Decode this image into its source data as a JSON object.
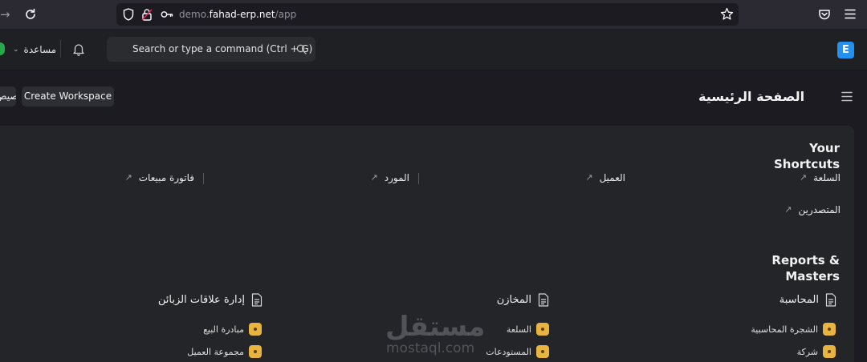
{
  "browser": {
    "url_prefix": "demo.",
    "url_host": "fahad-erp.net",
    "url_path": "/app",
    "icons": [
      "forward-icon",
      "reload-icon",
      "shield-icon",
      "lock-icon",
      "key-icon",
      "star-icon",
      "pocket-icon",
      "menu-icon"
    ]
  },
  "navbar": {
    "help_label": "مساعدة",
    "search_placeholder": "Search or type a command (Ctrl + G)",
    "logo_letter": "E",
    "avatar_color": "#27a84d",
    "logo_color": "#2490ef"
  },
  "page": {
    "title": "الصفحة الرئيسية",
    "create_workspace_label": "Create Workspace",
    "customize_label": "تخصيص"
  },
  "shortcuts": {
    "title": "Your Shortcuts",
    "items": [
      "السلعة",
      "العميل",
      "المورد",
      "فاتورة مبيعات",
      "المتصدرين"
    ]
  },
  "reports": {
    "title": "Reports & Masters",
    "groups": [
      {
        "title": "المحاسبة",
        "links": [
          "الشجرة المحاسبية",
          "شركة"
        ]
      },
      {
        "title": "المخازن",
        "links": [
          "السلعة",
          "المستودعات"
        ]
      },
      {
        "title": "إدارة علاقات الزبائن",
        "links": [
          "مبادرة البيع",
          "مجموعة العميل"
        ]
      }
    ]
  },
  "watermark": {
    "arabic": "مستقل",
    "latin": "mostaql.com"
  },
  "colors": {
    "bullet": "#e8b33f",
    "background": "#1c1b22"
  }
}
